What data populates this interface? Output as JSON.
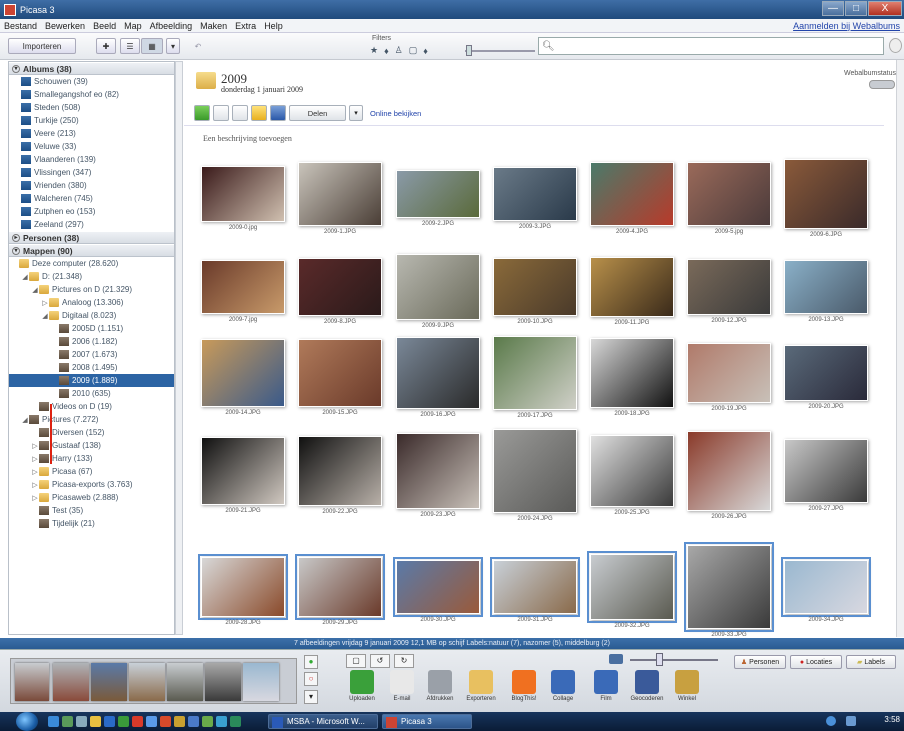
{
  "window": {
    "title": "Picasa 3",
    "btn_min": "—",
    "btn_max": "□",
    "btn_close": "X"
  },
  "menu": {
    "items": [
      "Bestand",
      "Bewerken",
      "Beeld",
      "Map",
      "Afbeelding",
      "Maken",
      "Extra",
      "Help"
    ],
    "signin": "Aanmelden bij Webalbums"
  },
  "toolbar": {
    "import": "Importeren",
    "filters_label": "Filters",
    "filter_icons": [
      "★",
      "♦",
      "♙",
      "▢",
      "♦"
    ]
  },
  "search": {
    "placeholder": "",
    "icon": "search-icon"
  },
  "left": {
    "albums_header": "Albums (38)",
    "albums": [
      "Schouwen (39)",
      "Smallegangshof eo (82)",
      "Steden (508)",
      "Turkije (250)",
      "Veere (213)",
      "Veluwe (33)",
      "Vlaanderen (139)",
      "Vlissingen (347)",
      "Vrienden (380)",
      "Walcheren (745)",
      "Zutphen eo (153)",
      "Zeeland (297)"
    ],
    "people_header": "Personen (38)",
    "folders_header": "Mappen (90)",
    "tree": [
      {
        "label": "Deze computer (28.620)",
        "indent": 0,
        "icon": "folder",
        "tri": ""
      },
      {
        "label": "D: (21.348)",
        "indent": 1,
        "icon": "folder",
        "tri": "◢"
      },
      {
        "label": "Pictures on D (21.329)",
        "indent": 2,
        "icon": "folder",
        "tri": "◢"
      },
      {
        "label": "Analoog (13.306)",
        "indent": 3,
        "icon": "folder",
        "tri": "▷"
      },
      {
        "label": "Digitaal (8.023)",
        "indent": 3,
        "icon": "folder",
        "tri": "◢"
      },
      {
        "label": "2005D (1.151)",
        "indent": 4,
        "icon": "thumb",
        "tri": ""
      },
      {
        "label": "2006 (1.182)",
        "indent": 4,
        "icon": "thumb",
        "tri": ""
      },
      {
        "label": "2007 (1.673)",
        "indent": 4,
        "icon": "thumb",
        "tri": ""
      },
      {
        "label": "2008 (1.495)",
        "indent": 4,
        "icon": "thumb",
        "tri": ""
      },
      {
        "label": "2009 (1.889)",
        "indent": 4,
        "icon": "thumb",
        "tri": "",
        "selected": true
      },
      {
        "label": "2010 (635)",
        "indent": 4,
        "icon": "thumb",
        "tri": ""
      },
      {
        "label": "Videos on D (19)",
        "indent": 2,
        "icon": "thumb",
        "tri": ""
      },
      {
        "label": "Pictures (7.272)",
        "indent": 1,
        "icon": "thumb",
        "tri": "◢"
      },
      {
        "label": "Diversen (152)",
        "indent": 2,
        "icon": "thumb",
        "tri": ""
      },
      {
        "label": "Gustaaf (138)",
        "indent": 2,
        "icon": "thumb",
        "tri": "▷"
      },
      {
        "label": "Harry (133)",
        "indent": 2,
        "icon": "thumb",
        "tri": "▷"
      },
      {
        "label": "Picasa (67)",
        "indent": 2,
        "icon": "folder",
        "tri": "▷"
      },
      {
        "label": "Picasa-exports (3.763)",
        "indent": 2,
        "icon": "folder",
        "tri": "▷"
      },
      {
        "label": "Picasaweb (2.888)",
        "indent": 2,
        "icon": "folder",
        "tri": "▷"
      },
      {
        "label": "Test (35)",
        "indent": 2,
        "icon": "thumb",
        "tri": ""
      },
      {
        "label": "Tijdelijk (21)",
        "indent": 2,
        "icon": "thumb",
        "tri": ""
      }
    ]
  },
  "main": {
    "folder_title": "2009",
    "folder_date": "donderdag 1 januari 2009",
    "web_label": "Webalbumstatus",
    "share_label": "Delen",
    "online_link": "Online bekijken",
    "caption": "Een beschrijving toevoegen",
    "photos": [
      {
        "name": "2009-0.jpg",
        "c1": "#3a1a1a",
        "c2": "#d0c0b0"
      },
      {
        "name": "2009-1.JPG",
        "c1": "#c9c4bb",
        "c2": "#4a3e36"
      },
      {
        "name": "2009-2.JPG",
        "c1": "#8a9aa8",
        "c2": "#5a6a3a"
      },
      {
        "name": "2009-3.JPG",
        "c1": "#6a7a88",
        "c2": "#2a3a4a"
      },
      {
        "name": "2009-4.JPG",
        "c1": "#4a7a6a",
        "c2": "#b83a2a"
      },
      {
        "name": "2009-5.jpg",
        "c1": "#9a6a5a",
        "c2": "#4a3a3a"
      },
      {
        "name": "2009-6.JPG",
        "c1": "#8a5a3a",
        "c2": "#3a2a2a"
      },
      {
        "name": "2009-7.jpg",
        "c1": "#6a3a2a",
        "c2": "#c89a6a"
      },
      {
        "name": "2009-8.JPG",
        "c1": "#5a2a2a",
        "c2": "#2a1a1a"
      },
      {
        "name": "2009-9.JPG",
        "c1": "#b8b8b0",
        "c2": "#6a6a5a"
      },
      {
        "name": "2009-10.JPG",
        "c1": "#8a6a3a",
        "c2": "#4a3a2a"
      },
      {
        "name": "2009-11.JPG",
        "c1": "#b8904a",
        "c2": "#3a2a1a"
      },
      {
        "name": "2009-12.JPG",
        "c1": "#7a6a5a",
        "c2": "#3a3a3a"
      },
      {
        "name": "2009-13.JPG",
        "c1": "#8ab0c8",
        "c2": "#4a5a6a"
      },
      {
        "name": "2009-14.JPG",
        "c1": "#c89a5a",
        "c2": "#3a5a8a"
      },
      {
        "name": "2009-15.JPG",
        "c1": "#b07a5a",
        "c2": "#6a3a2a"
      },
      {
        "name": "2009-16.JPG",
        "c1": "#7a8898",
        "c2": "#2a2a2a"
      },
      {
        "name": "2009-17.JPG",
        "c1": "#5a7a4a",
        "c2": "#d0d0c8"
      },
      {
        "name": "2009-18.JPG",
        "c1": "#d8d8d8",
        "c2": "#111111"
      },
      {
        "name": "2009-19.JPG",
        "c1": "#b07a6a",
        "c2": "#c8c0b8"
      },
      {
        "name": "2009-20.JPG",
        "c1": "#5a6a7a",
        "c2": "#2a2a3a"
      },
      {
        "name": "2009-21.JPG",
        "c1": "#101010",
        "c2": "#d0c8c0"
      },
      {
        "name": "2009-22.JPG",
        "c1": "#101010",
        "c2": "#b8b0a8"
      },
      {
        "name": "2009-23.JPG",
        "c1": "#3a2a2a",
        "c2": "#c8c0b8"
      },
      {
        "name": "2009-24.JPG",
        "c1": "#9a9a98",
        "c2": "#5a5a58"
      },
      {
        "name": "2009-25.JPG",
        "c1": "#e0e0e0",
        "c2": "#3a3a3a"
      },
      {
        "name": "2009-26.JPG",
        "c1": "#8a3a2a",
        "c2": "#d8d8d8"
      },
      {
        "name": "2009-27.JPG",
        "c1": "#c8c8c8",
        "c2": "#3a3a3a"
      },
      {
        "name": "2009-28.JPG",
        "c1": "#d8d8d8",
        "c2": "#8a4a2a"
      },
      {
        "name": "2009-29.JPG",
        "c1": "#c8c8c8",
        "c2": "#6a3a2a"
      },
      {
        "name": "2009-30.JPG",
        "c1": "#5a7aa8",
        "c2": "#9a5a3a"
      },
      {
        "name": "2009-31.JPG",
        "c1": "#c8d0d8",
        "c2": "#8a6a4a"
      },
      {
        "name": "2009-32.JPG",
        "c1": "#c8ccd0",
        "c2": "#5a5a50"
      },
      {
        "name": "2009-33.JPG",
        "c1": "#a8a8a8",
        "c2": "#3a3a3a"
      },
      {
        "name": "2009-34.JPG",
        "c1": "#9ab8d0",
        "c2": "#d8d8e0"
      }
    ]
  },
  "status": {
    "text": "7 afbeeldingen   vrijdag 9 januari 2009   12,1 MB op schijf   Labels:natuur (7), nazomer (5), middelburg (2)"
  },
  "tray": {
    "buttons": [
      "Uploaden",
      "E-mail",
      "Afdrukken",
      "Exporteren",
      "BlogThis!",
      "Collage",
      "Film",
      "Geocoderen",
      "Winkel"
    ],
    "people_btn": "Personen",
    "location_btn": "Locaties",
    "labels_btn": "Labels",
    "accent": "#2c64a4"
  },
  "taskbar": {
    "tasks": [
      "MSBA - Microsoft W...",
      "Picasa 3"
    ],
    "clock": "3:58"
  }
}
